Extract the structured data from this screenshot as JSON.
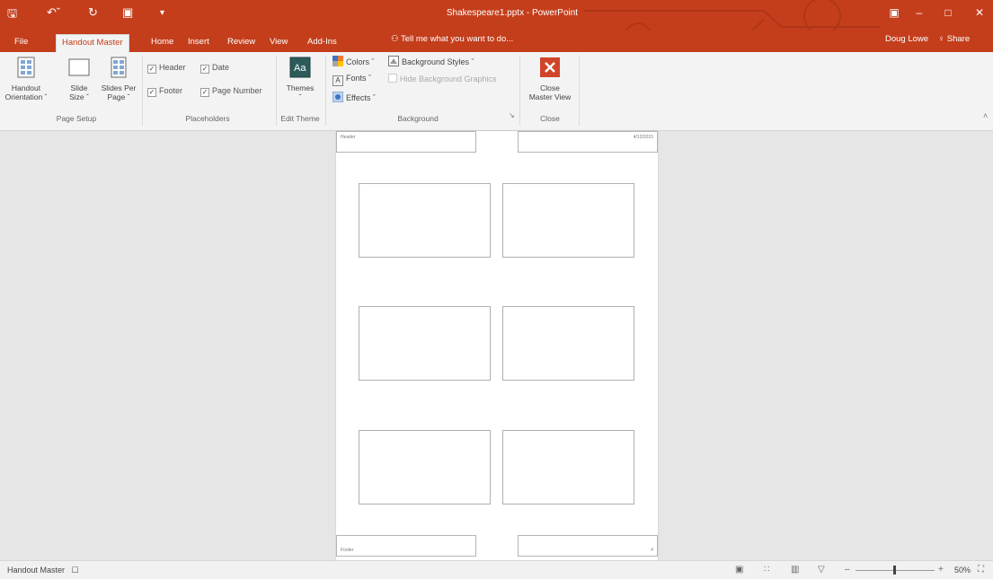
{
  "window": {
    "title": "Shakespeare1.pptx - PowerPoint",
    "user": "Doug Lowe",
    "share": "Share"
  },
  "qat": {
    "save_icon": "save-icon",
    "undo_icon": "undo-icon",
    "redo_icon": "redo-icon"
  },
  "tabs": [
    "File",
    "Handout Master",
    "Home",
    "Insert",
    "Review",
    "View",
    "Add-Ins"
  ],
  "active_tab": "Handout Master",
  "tell_me": "Tell me what you want to do...",
  "ribbon": {
    "page_setup": {
      "label": "Page Setup",
      "orientation": [
        "Handout",
        "Orientation ˇ"
      ],
      "slide_size": [
        "Slide",
        "Size ˇ"
      ],
      "slides_per_page": [
        "Slides Per",
        "Page ˇ"
      ]
    },
    "placeholders": {
      "label": "Placeholders",
      "header": "Header",
      "date": "Date",
      "footer": "Footer",
      "page_number": "Page Number"
    },
    "edit_theme": {
      "label": "Edit Theme",
      "themes": "Themes"
    },
    "background": {
      "label": "Background",
      "colors": "Colors ˇ",
      "fonts": "Fonts ˇ",
      "effects": "Effects ˇ",
      "background_styles": "Background Styles ˇ",
      "hide_graphics": "Hide Background Graphics"
    },
    "close": {
      "label": "Close",
      "close_master": [
        "Close",
        "Master View"
      ]
    }
  },
  "handout": {
    "header_text": "Header",
    "date_text": "4/12/2015",
    "footer_text": "Footer",
    "page_number_text": "#",
    "slides_per_page": 6
  },
  "status": {
    "mode": "Handout Master",
    "zoom": "50%"
  },
  "colors": {
    "accent": "#c43e1c",
    "ribbon_bg": "#f3f3f3",
    "canvas_bg": "#e6e6e6"
  }
}
